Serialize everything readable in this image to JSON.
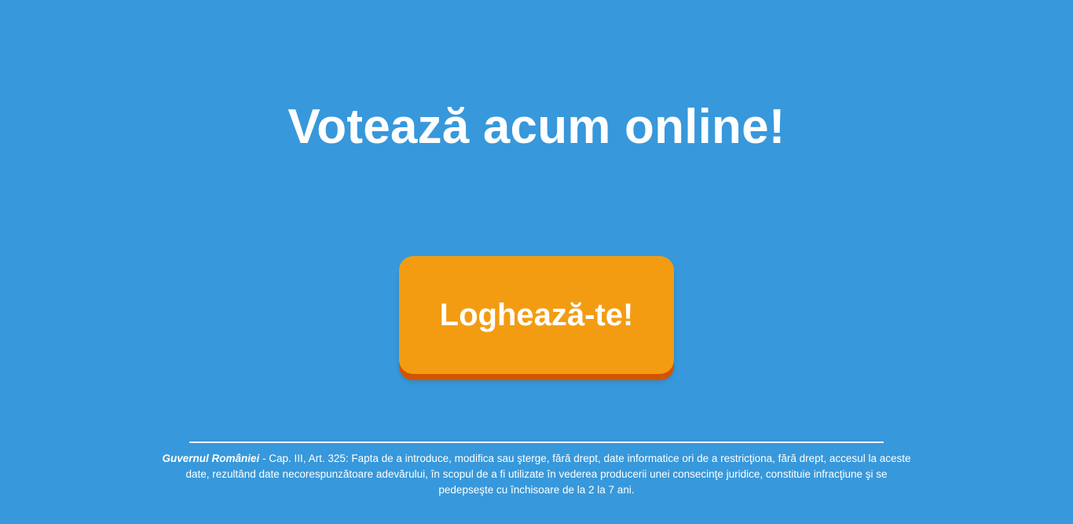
{
  "page": {
    "headline": "Votează acum online!",
    "login_button_label": "Loghează-te!"
  },
  "footer": {
    "source": "Guvernul României",
    "legal_text": " - Cap. III, Art. 325: Fapta de a introduce, modifica sau şterge, fără drept, date informatice ori de a restricţiona, fără drept, accesul la aceste date, rezultând date necorespunzătoare adevărului, în scopul de a fi utilizate în vederea producerii unei consecinţe juridice, constituie infracţiune şi se pedepseşte cu închisoare de la 2 la 7 ani."
  },
  "colors": {
    "background": "#3798db",
    "button": "#f39c12",
    "button_shadow": "#d35400",
    "text": "#ffffff"
  }
}
